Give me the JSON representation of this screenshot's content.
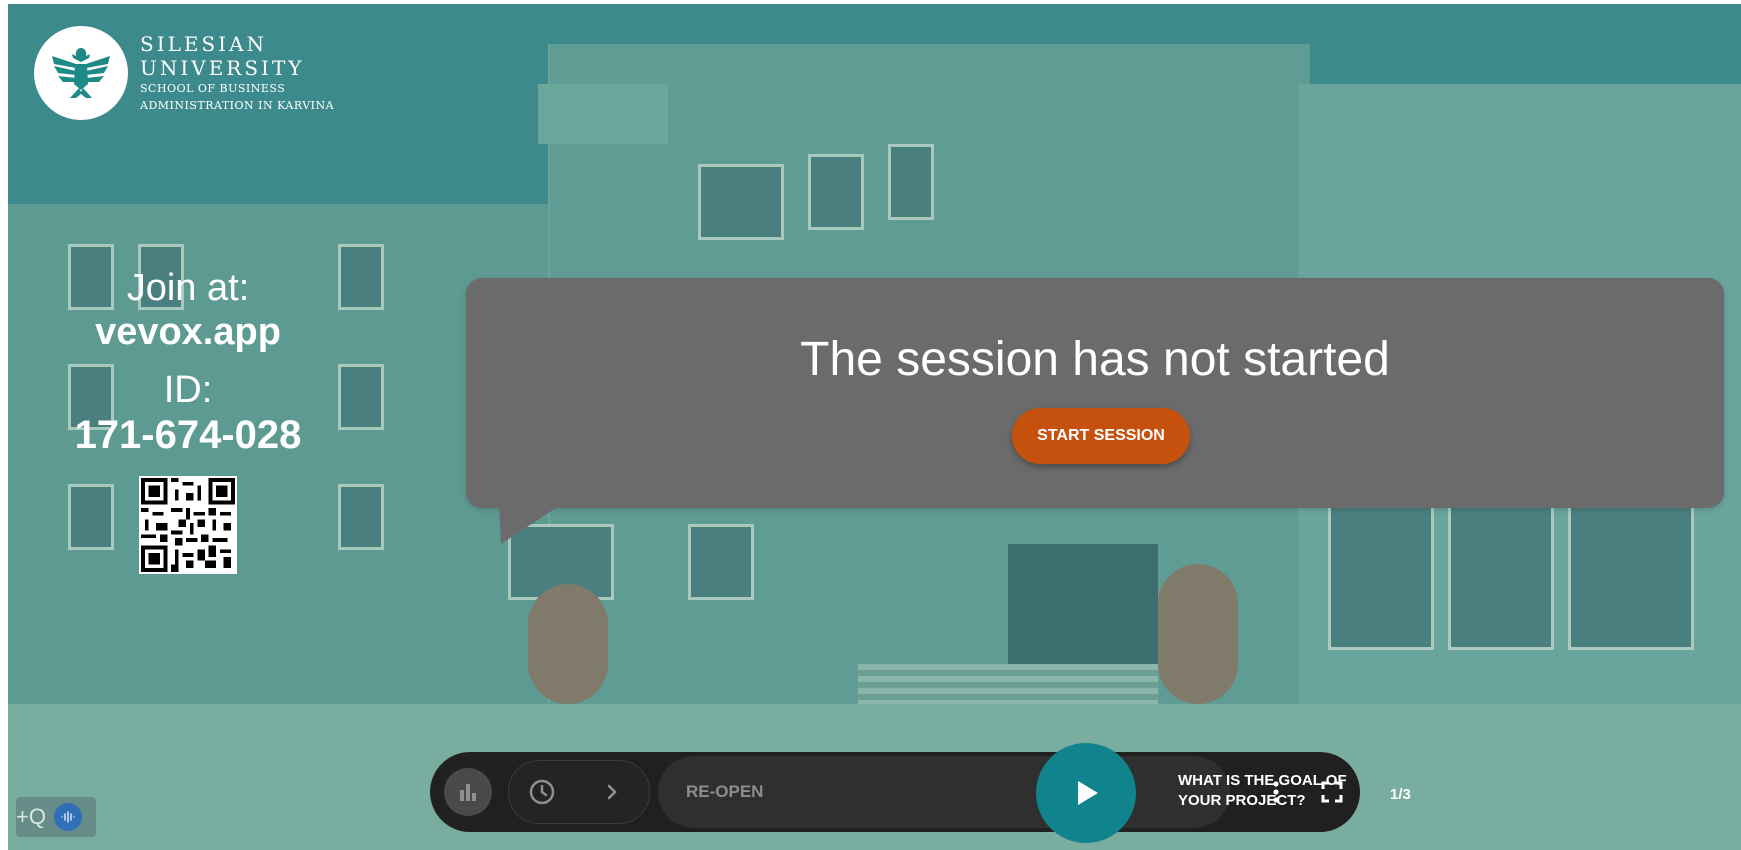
{
  "logo": {
    "line1": "SILESIAN",
    "line2": "UNIVERSITY",
    "line3": "SCHOOL OF BUSINESS",
    "line4": "ADMINISTRATION IN KARVINA",
    "icon": "eagle-icon",
    "brand_color": "#1e8a86"
  },
  "join": {
    "label": "Join at:",
    "url": "vevox.app",
    "id_label": "ID:",
    "id": "171-674-028",
    "qr_icon": "qr-code-icon"
  },
  "session": {
    "title": "The session has not started",
    "start_label": "START SESSION",
    "start_color": "#c6510f"
  },
  "controls": {
    "results_icon": "bar-chart-icon",
    "timer_icon": "clock-icon",
    "next_icon": "chevron-right-icon",
    "reopen_label": "RE-OPEN",
    "play_icon": "play-icon",
    "question": "WHAT IS THE GOAL OF YOUR PROJECT?",
    "question_counter": "1/3",
    "more_icon": "more-vertical-icon",
    "fullscreen_icon": "fullscreen-icon",
    "accent": "#10838d"
  },
  "corner": {
    "label": "+Q",
    "icon": "audio-wave-icon"
  }
}
